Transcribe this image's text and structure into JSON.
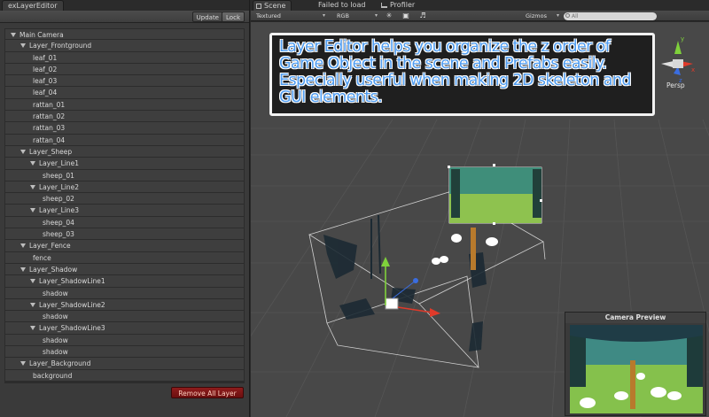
{
  "left_panel": {
    "tab_title": "exLayerEditor",
    "toolbar": {
      "update_label": "Update",
      "lock_label": "Lock"
    },
    "tree": [
      {
        "label": "Main Camera",
        "level": 0,
        "expanded": true
      },
      {
        "label": "Layer_Frontground",
        "level": 1,
        "expanded": true
      },
      {
        "label": "leaf_01",
        "level": 2
      },
      {
        "label": "leaf_02",
        "level": 2
      },
      {
        "label": "leaf_03",
        "level": 2
      },
      {
        "label": "leaf_04",
        "level": 2
      },
      {
        "label": "rattan_01",
        "level": 2
      },
      {
        "label": "rattan_02",
        "level": 2
      },
      {
        "label": "rattan_03",
        "level": 2
      },
      {
        "label": "rattan_04",
        "level": 2
      },
      {
        "label": "Layer_Sheep",
        "level": 1,
        "expanded": true
      },
      {
        "label": "Layer_Line1",
        "level": 2,
        "expanded": true
      },
      {
        "label": "sheep_01",
        "level": 3
      },
      {
        "label": "Layer_Line2",
        "level": 2,
        "expanded": true
      },
      {
        "label": "sheep_02",
        "level": 3
      },
      {
        "label": "Layer_Line3",
        "level": 2,
        "expanded": true
      },
      {
        "label": "sheep_04",
        "level": 3
      },
      {
        "label": "sheep_03",
        "level": 3
      },
      {
        "label": "Layer_Fence",
        "level": 1,
        "expanded": true
      },
      {
        "label": "fence",
        "level": 2
      },
      {
        "label": "Layer_Shadow",
        "level": 1,
        "expanded": true
      },
      {
        "label": "Layer_ShadowLine1",
        "level": 2,
        "expanded": true
      },
      {
        "label": "shadow",
        "level": 3
      },
      {
        "label": "Layer_ShadowLine2",
        "level": 2,
        "expanded": true
      },
      {
        "label": "shadow",
        "level": 3
      },
      {
        "label": "Layer_ShadowLine3",
        "level": 2,
        "expanded": true
      },
      {
        "label": "shadow",
        "level": 3
      },
      {
        "label": "shadow",
        "level": 3
      },
      {
        "label": "Layer_Background",
        "level": 1,
        "expanded": true
      },
      {
        "label": "background",
        "level": 2
      }
    ],
    "remove_all_label": "Remove All Layer"
  },
  "scene_panel": {
    "tabs": [
      {
        "label": "Scene",
        "icon": "grid-icon",
        "active": true
      },
      {
        "label": "Failed to load",
        "active": false
      },
      {
        "label": "Profiler",
        "icon": "chart-icon",
        "active": false
      }
    ],
    "toolbar": {
      "render_mode": "Textured",
      "channel": "RGB",
      "lighting_icon": "sun-icon",
      "image_icon": "image-icon",
      "audio_icon": "speaker-icon",
      "gizmos_label": "Gizmos",
      "search_placeholder": "All"
    },
    "banner_text": "Layer Editor helps you organize the z order of Game Object in the scene and Prefabs easily. Especially userful when making 2D skeleton and GUI elements.",
    "view_label": "Persp",
    "camera_preview_title": "Camera Preview",
    "colors": {
      "banner_text": "#4f9cf0",
      "remove_button": "#8e1c1c",
      "axis_x": "#e03a2a",
      "axis_y": "#7fd13b",
      "axis_z": "#3a6de0"
    }
  }
}
